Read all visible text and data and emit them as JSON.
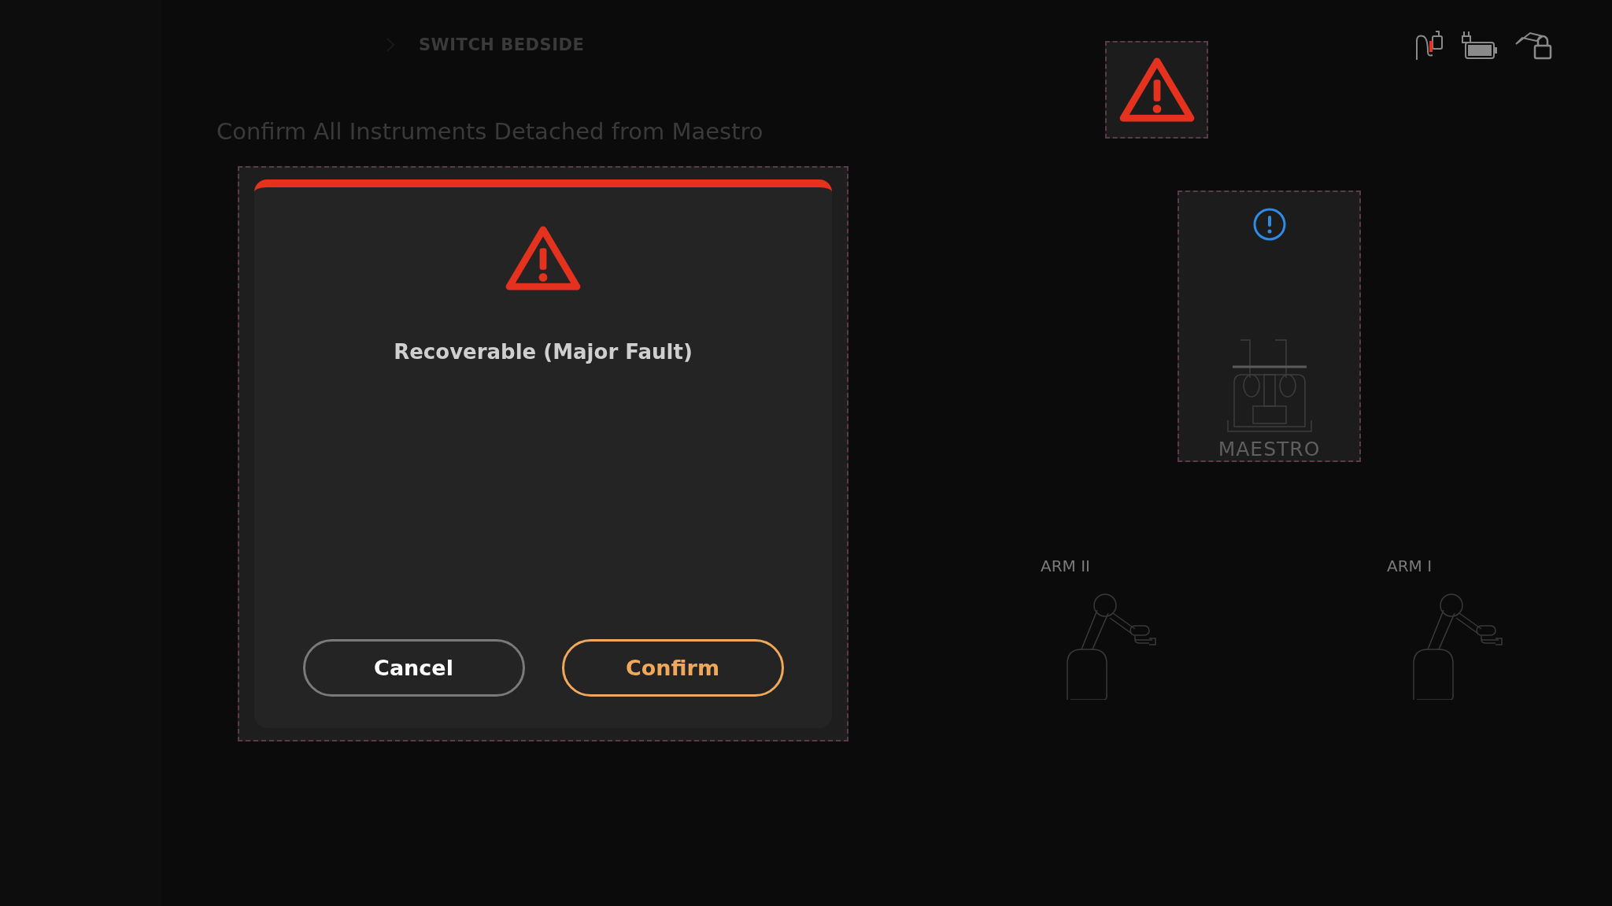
{
  "breadcrumb": {
    "current": "SWITCH BEDSIDE"
  },
  "heading": "Confirm All Instruments Detached from Maestro",
  "dialog": {
    "title": "Recoverable (Major Fault)",
    "buttons": [
      {
        "label": "Cancel",
        "kind": "secondary"
      },
      {
        "label": "Confirm",
        "kind": "primary"
      }
    ]
  },
  "fault_indicator": {
    "alert": true
  },
  "status_icons": [
    {
      "kind": "cable",
      "alert": true
    },
    {
      "kind": "battery",
      "alert": false
    },
    {
      "kind": "lock",
      "alert": false
    }
  ],
  "maestro": {
    "label": "MAESTRO",
    "alert": true
  },
  "arms": [
    {
      "label": "ARM II"
    },
    {
      "label": "ARM I"
    }
  ]
}
